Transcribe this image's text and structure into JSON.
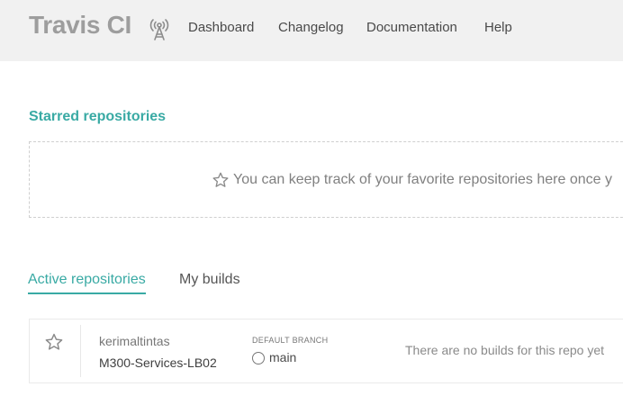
{
  "header": {
    "brand": "Travis CI",
    "icon": "broadcast-tower-icon",
    "nav": [
      {
        "label": "Dashboard"
      },
      {
        "label": "Changelog"
      },
      {
        "label": "Documentation"
      },
      {
        "label": "Help"
      }
    ]
  },
  "starred": {
    "title": "Starred repositories",
    "empty_icon": "star-outline-icon",
    "empty_message": "You can keep track of your favorite repositories here once y"
  },
  "tabs": [
    {
      "label": "Active repositories",
      "active": true
    },
    {
      "label": "My builds",
      "active": false
    }
  ],
  "repositories": [
    {
      "owner": "kerimaltintas",
      "name": "M300-Services-LB02",
      "default_branch_label": "DEFAULT BRANCH",
      "branch": "main",
      "status_text": "There are no builds for this repo yet"
    }
  ],
  "colors": {
    "accent": "#39aaa4",
    "header_bg": "#f1f1f1",
    "brand_text": "#9d9d9d"
  }
}
